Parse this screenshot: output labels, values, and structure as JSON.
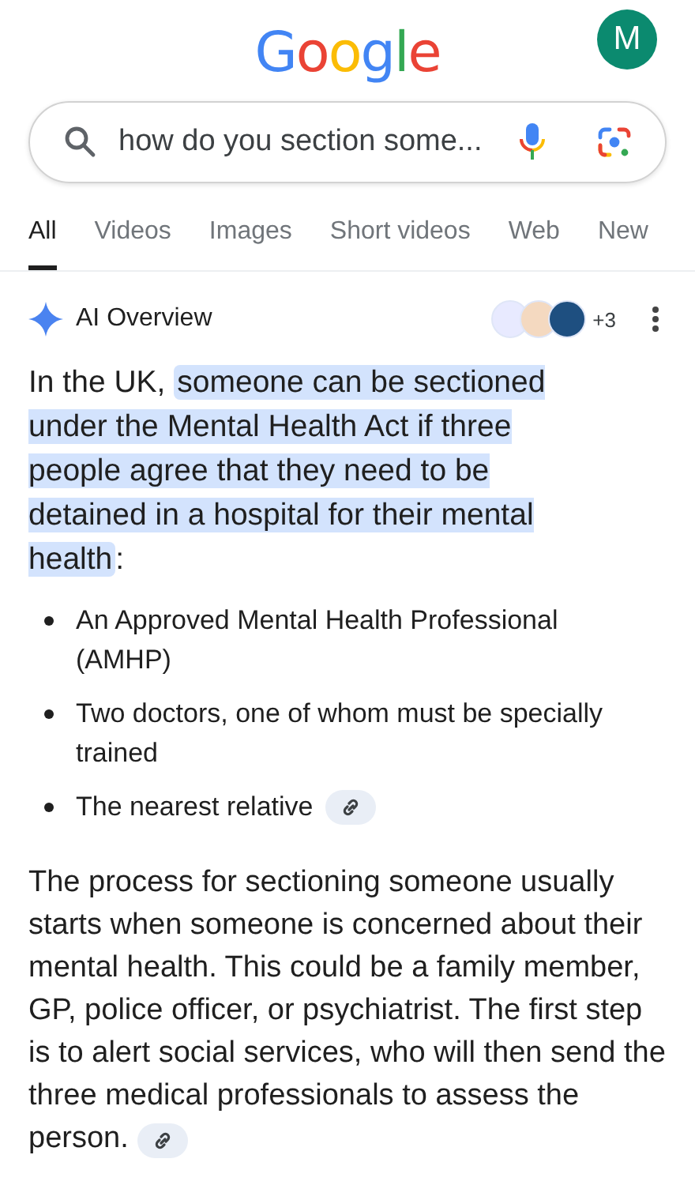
{
  "header": {
    "logo": "Google",
    "avatar_letter": "M"
  },
  "search": {
    "value": "how do you section some..."
  },
  "tabs": [
    {
      "label": "All",
      "selected": true
    },
    {
      "label": "Videos",
      "selected": false
    },
    {
      "label": "Images",
      "selected": false
    },
    {
      "label": "Short videos",
      "selected": false
    },
    {
      "label": "Web",
      "selected": false
    },
    {
      "label": "New",
      "selected": false
    }
  ],
  "overview": {
    "title": "AI Overview",
    "sources_more": "+3",
    "intro": {
      "lead": "In the UK, ",
      "highlight": "someone can be sectioned under the Mental Health Act if three people agree that they need to be detained in a hospital for their mental health",
      "tail": ":"
    },
    "bullets": [
      {
        "text": "An Approved Mental Health Professional (AMHP)",
        "cited": false
      },
      {
        "text": "Two doctors, one of whom must be specially trained",
        "cited": false
      },
      {
        "text": "The nearest relative",
        "cited": true
      }
    ],
    "paragraph": {
      "text": "The process for sectioning someone usually starts when someone is concerned about their mental health. This could be a family member, GP, police officer, or psychiatrist. The first step is to alert social services, who will then send the three medical professionals to assess the person.",
      "cited": true
    }
  }
}
